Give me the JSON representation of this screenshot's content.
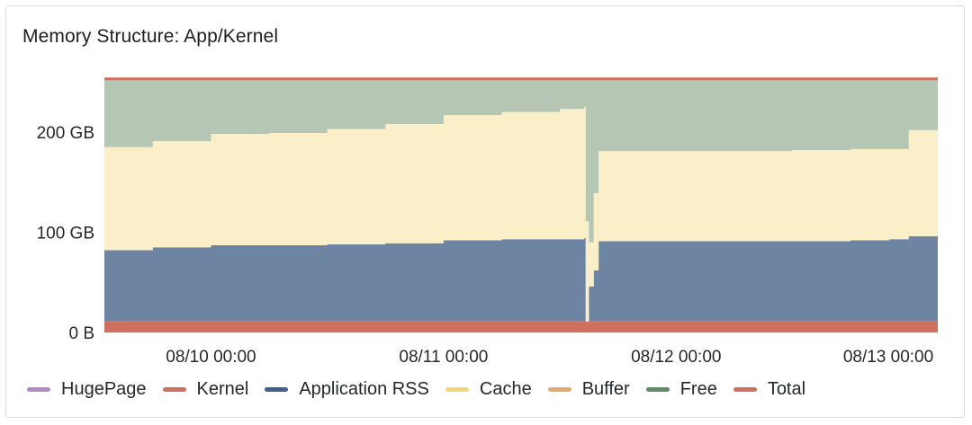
{
  "panel": {
    "title": "Memory Structure: App/Kernel"
  },
  "chart_data": {
    "type": "area",
    "title": "Memory Structure: App/Kernel",
    "stacked": true,
    "y_unit": "GB",
    "ylim": [
      0,
      260
    ],
    "y_ticks": [
      {
        "value": 0,
        "label": "0 B"
      },
      {
        "value": 100,
        "label": "100 GB"
      },
      {
        "value": 200,
        "label": "200 GB"
      }
    ],
    "x_ticks": [
      "08/10 00:00",
      "08/11 00:00",
      "08/12 00:00",
      "08/13 00:00"
    ],
    "x": [
      "08/09 13:00",
      "08/09 18:00",
      "08/10 00:00",
      "08/10 06:00",
      "08/10 12:00",
      "08/10 18:00",
      "08/11 00:00",
      "08/11 06:00",
      "08/11 12:00",
      "08/11 14:30",
      "08/11 14:40",
      "08/11 15:00",
      "08/11 15:30",
      "08/11 16:00",
      "08/11 18:00",
      "08/12 00:00",
      "08/12 06:00",
      "08/12 12:00",
      "08/12 18:00",
      "08/12 22:00",
      "08/13 00:00",
      "08/13 03:00"
    ],
    "grid": true,
    "legend_position": "bottom",
    "series": [
      {
        "name": "HugePage",
        "color": "#b18bc5",
        "values": [
          0,
          0,
          0,
          0,
          0,
          0,
          0,
          0,
          0,
          0,
          0,
          0,
          0,
          0,
          0,
          0,
          0,
          0,
          0,
          0,
          0,
          0
        ]
      },
      {
        "name": "Kernel",
        "color": "#d0705e",
        "values": [
          11,
          11,
          11,
          11,
          11,
          11,
          11,
          11,
          11,
          11,
          11,
          11,
          11,
          11,
          11,
          11,
          11,
          11,
          11,
          11,
          11,
          11
        ]
      },
      {
        "name": "Application RSS",
        "color": "#6e84a3",
        "values": [
          71,
          74,
          76,
          76,
          77,
          78,
          81,
          82,
          82,
          83,
          0,
          35,
          51,
          80,
          80,
          80,
          80,
          80,
          81,
          82,
          85,
          86
        ]
      },
      {
        "name": "Cache",
        "color": "#fbefc9",
        "values": [
          103,
          106,
          111,
          112,
          115,
          119,
          125,
          127,
          130,
          131,
          100,
          44,
          77,
          90,
          90,
          90,
          90,
          91,
          91,
          90,
          106,
          106
        ]
      },
      {
        "name": "Buffer",
        "color": "#e8b28a",
        "values": [
          0,
          0,
          0,
          0,
          0,
          0,
          0,
          0,
          0,
          0,
          0,
          0,
          0,
          0,
          0,
          0,
          0,
          0,
          0,
          0,
          0,
          0
        ]
      },
      {
        "name": "Free",
        "color": "#b6c6b5",
        "values": [
          68,
          62,
          55,
          54,
          50,
          45,
          36,
          33,
          30,
          28,
          142,
          163,
          114,
          72,
          72,
          72,
          72,
          71,
          70,
          70,
          51,
          50
        ]
      },
      {
        "name": "Total",
        "color": "#d0705e",
        "values": [
          253,
          253,
          253,
          253,
          253,
          253,
          253,
          253,
          253,
          253,
          253,
          253,
          253,
          253,
          253,
          253,
          253,
          253,
          253,
          253,
          253,
          253
        ]
      }
    ]
  },
  "legend": {
    "items": [
      {
        "label": "HugePage",
        "color": "#b18bc5"
      },
      {
        "label": "Kernel",
        "color": "#d0705e"
      },
      {
        "label": "Application RSS",
        "color": "#3f5f8f"
      },
      {
        "label": "Cache",
        "color": "#f2d67a"
      },
      {
        "label": "Buffer",
        "color": "#e8a870"
      },
      {
        "label": "Free",
        "color": "#5f8f63"
      },
      {
        "label": "Total",
        "color": "#d0705e"
      }
    ]
  }
}
